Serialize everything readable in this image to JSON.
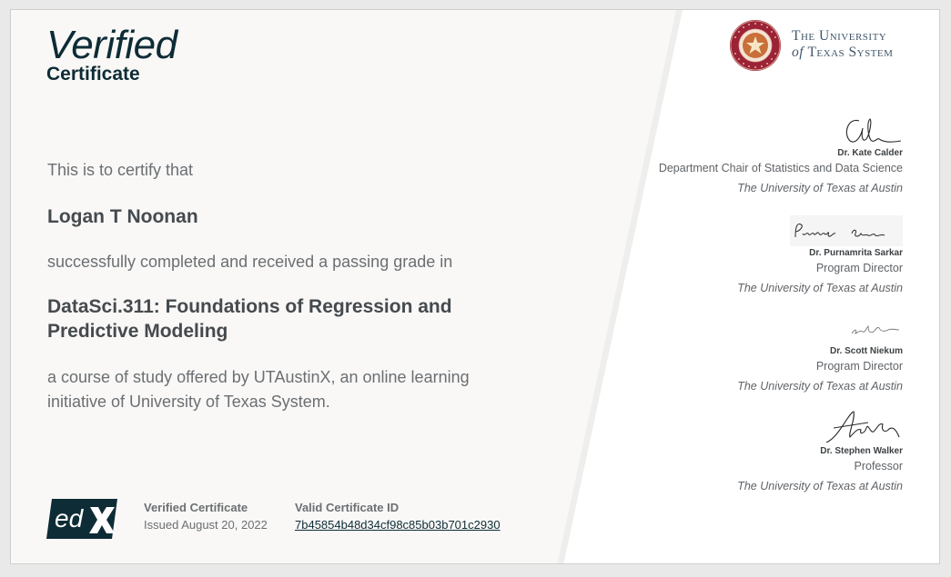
{
  "header": {
    "verified_title": "Verified",
    "verified_subtitle": "Certificate"
  },
  "body": {
    "intro": "This is to certify that",
    "learner_name": "Logan T Noonan",
    "completed_text": "successfully completed and received a passing grade in",
    "course_title": "DataSci.311: Foundations of Regression and Predictive Modeling",
    "offered_text": "a course of study offered by UTAustinX, an online learning initiative of University of Texas System."
  },
  "footer": {
    "logo_text": "edX",
    "cert_type_label": "Verified Certificate",
    "issued_text": "Issued August 20, 2022",
    "cert_id_label": "Valid Certificate ID",
    "cert_id_value": "7b45854b48d34cf98c85b03b701c2930"
  },
  "institution": {
    "name_line1": "The University",
    "name_line2_prefix": "of",
    "name_line2_rest": "Texas System",
    "seal_name": "seal-of-the-university-of-texas-system"
  },
  "signatories": [
    {
      "name": "Dr. Kate Calder",
      "title": "Department Chair of Statistics and Data Science",
      "institution": "The University of Texas at Austin"
    },
    {
      "name": "Dr. Purnamrita Sarkar",
      "title": "Program Director",
      "institution": "The University of Texas at Austin"
    },
    {
      "name": "Dr. Scott Niekum",
      "title": "Program Director",
      "institution": "The University of Texas at Austin"
    },
    {
      "name": "Dr. Stephen Walker",
      "title": "Professor",
      "institution": "The University of Texas at Austin"
    }
  ],
  "colors": {
    "brand_dark": "#0e2c36",
    "seal_red": "#9b2335",
    "panel_white": "#ffffff"
  }
}
